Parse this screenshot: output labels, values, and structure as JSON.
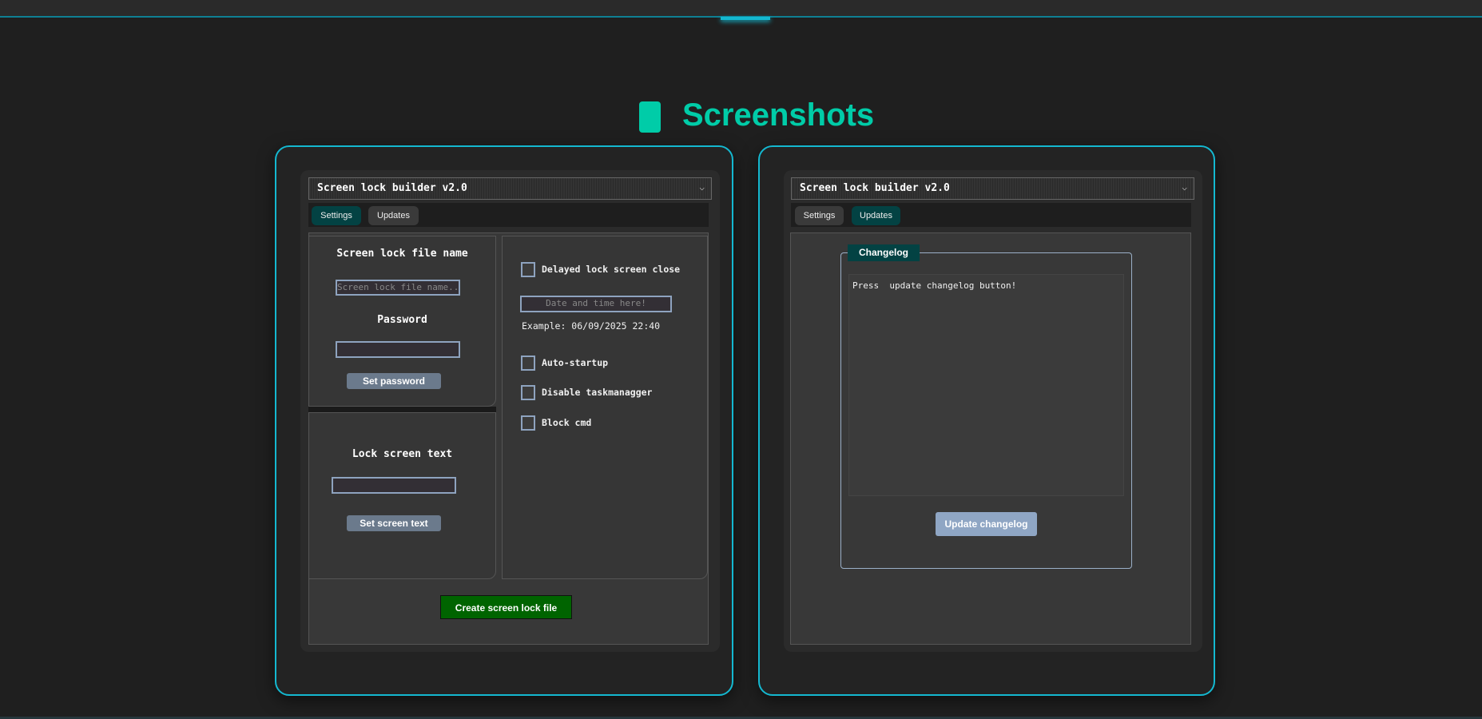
{
  "section_title": "Screenshots",
  "colors": {
    "accent": "#00cca8",
    "card_border": "#14b8d0",
    "create_button": "#006400"
  },
  "left_screenshot": {
    "window_title": "Screen lock builder v2.0",
    "chevron": "⌵",
    "tabs": [
      {
        "label": "Settings",
        "active": true
      },
      {
        "label": "Updates",
        "active": false
      }
    ],
    "file_name_label": "Screen lock file name",
    "file_name_placeholder": "Screen lock file name...",
    "password_label": "Password",
    "set_password": "Set password",
    "lock_text_label": "Lock screen text",
    "set_screen_text": "Set screen text",
    "delayed_close": "Delayed lock screen close",
    "date_placeholder": "Date and time here!",
    "example": "Example: 06/09/2025 22:40",
    "auto_startup": "Auto-startup",
    "disable_taskmanager": "Disable taskmanagger",
    "block_cmd": "Block cmd",
    "create_button": "Create screen lock file"
  },
  "right_screenshot": {
    "window_title": "Screen lock builder v2.0",
    "chevron": "⌵",
    "tabs": [
      {
        "label": "Settings",
        "active": false
      },
      {
        "label": "Updates",
        "active": true
      }
    ],
    "changelog_legend": "Changelog",
    "changelog_text": "Press  update changelog button!",
    "update_button": "Update changelog"
  }
}
